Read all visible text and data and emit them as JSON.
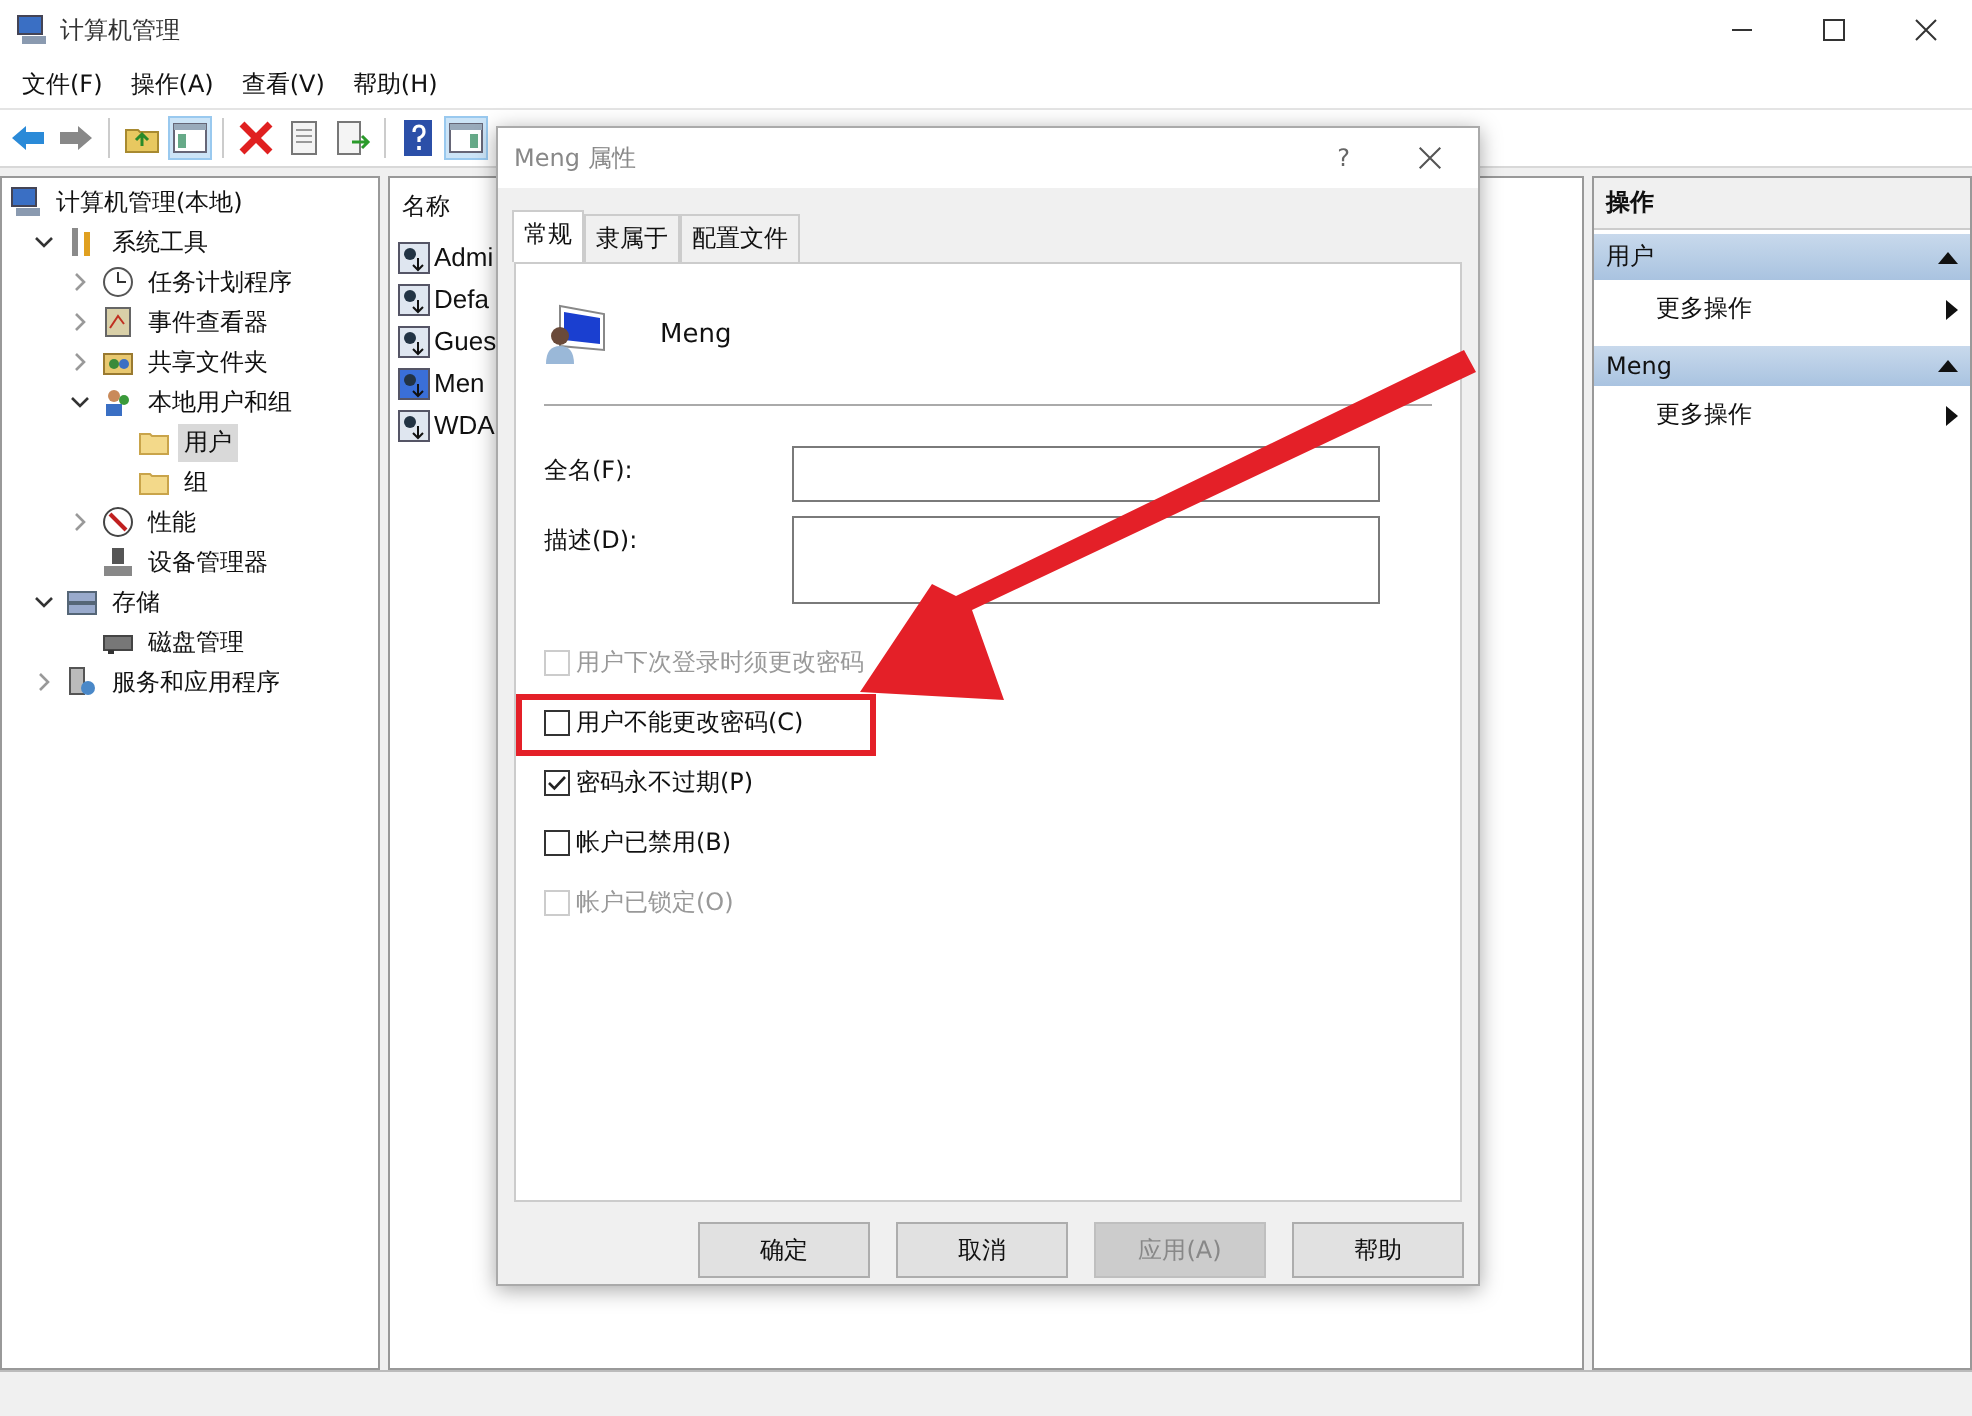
{
  "window": {
    "title": "计算机管理"
  },
  "menu": [
    "文件(F)",
    "操作(A)",
    "查看(V)",
    "帮助(H)"
  ],
  "tree": [
    {
      "label": "计算机管理(本地)",
      "kind": "computer",
      "selected": false,
      "children": [
        {
          "label": "系统工具",
          "kind": "tools",
          "expanded": true,
          "selected": false,
          "children": [
            {
              "label": "任务计划程序",
              "kind": "clock",
              "expanded": false,
              "selected": false
            },
            {
              "label": "事件查看器",
              "kind": "log",
              "expanded": false,
              "selected": false
            },
            {
              "label": "共享文件夹",
              "kind": "share",
              "expanded": false,
              "selected": false
            },
            {
              "label": "本地用户和组",
              "kind": "users",
              "expanded": true,
              "selected": false,
              "children": [
                {
                  "label": "用户",
                  "kind": "folder",
                  "selected": true
                },
                {
                  "label": "组",
                  "kind": "folder",
                  "selected": false
                }
              ]
            },
            {
              "label": "性能",
              "kind": "perf",
              "expanded": false,
              "selected": false
            },
            {
              "label": "设备管理器",
              "kind": "device",
              "selected": false
            }
          ]
        },
        {
          "label": "存储",
          "kind": "storage",
          "expanded": true,
          "selected": false,
          "children": [
            {
              "label": "磁盘管理",
              "kind": "disk",
              "selected": false
            }
          ]
        },
        {
          "label": "服务和应用程序",
          "kind": "services",
          "expanded": false,
          "selected": false
        }
      ]
    }
  ],
  "list": {
    "column": "名称",
    "rows": [
      {
        "name": "Admi",
        "selected": false
      },
      {
        "name": "Defa",
        "selected": false
      },
      {
        "name": "Gues",
        "selected": false
      },
      {
        "name": "Men",
        "selected": true
      },
      {
        "name": "WDA",
        "selected": false
      }
    ]
  },
  "actions": {
    "title": "操作",
    "sections": [
      {
        "title": "用户",
        "items": [
          "更多操作"
        ]
      },
      {
        "title": "Meng",
        "items": [
          "更多操作"
        ]
      }
    ]
  },
  "dialog": {
    "title": "Meng 属性",
    "help": "?",
    "tabs": [
      {
        "label": "常规",
        "selected": true
      },
      {
        "label": "隶属于",
        "selected": false
      },
      {
        "label": "配置文件",
        "selected": false
      }
    ],
    "user": "Meng",
    "fields": [
      {
        "label": "全名(F):",
        "kind": "line"
      },
      {
        "label": "描述(D):",
        "kind": "area"
      }
    ],
    "checkboxes": [
      {
        "label": "用户下次登录时须更改密码",
        "checked": false,
        "disabled": true,
        "highlighted": false
      },
      {
        "label": "用户不能更改密码(C)",
        "checked": false,
        "disabled": false,
        "highlighted": true
      },
      {
        "label": "密码永不过期(P)",
        "checked": true,
        "disabled": false,
        "highlighted": false
      },
      {
        "label": "帐户已禁用(B)",
        "checked": false,
        "disabled": false,
        "highlighted": false
      },
      {
        "label": "帐户已锁定(O)",
        "checked": false,
        "disabled": true,
        "highlighted": false
      }
    ],
    "buttons": [
      {
        "label": "确定",
        "disabled": false
      },
      {
        "label": "取消",
        "disabled": false
      },
      {
        "label": "应用(A)",
        "disabled": true
      },
      {
        "label": "帮助",
        "disabled": false
      }
    ]
  }
}
